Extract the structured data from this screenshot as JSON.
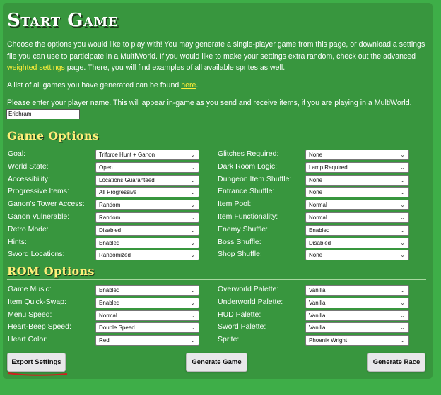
{
  "title": "Start Game",
  "intro": {
    "p1_a": "Choose the options you would like to play with! You may generate a single-player game from this page, or download a settings file you can use to participate in a MultiWorld. If you would like to make your settings extra random, check out the advanced ",
    "p1_link": "weighted settings",
    "p1_b": " page. There, you will find examples of all available sprites as well.",
    "p2_a": "A list of all games you have generated can be found ",
    "p2_link": "here",
    "p2_b": ".",
    "p3": "Please enter your player name. This will appear in-game as you send and receive items, if you are playing in a MultiWorld."
  },
  "player_name": "Eriphram",
  "game_options": {
    "heading": "Game Options",
    "left": [
      {
        "label": "Goal:",
        "value": "Triforce Hunt + Ganon"
      },
      {
        "label": "World State:",
        "value": "Open"
      },
      {
        "label": "Accessibility:",
        "value": "Locations Guaranteed"
      },
      {
        "label": "Progressive Items:",
        "value": "All Progressive"
      },
      {
        "label": "Ganon's Tower Access:",
        "value": "Random"
      },
      {
        "label": "Ganon Vulnerable:",
        "value": "Random"
      },
      {
        "label": "Retro Mode:",
        "value": "Disabled"
      },
      {
        "label": "Hints:",
        "value": "Enabled"
      },
      {
        "label": "Sword Locations:",
        "value": "Randomized"
      }
    ],
    "right": [
      {
        "label": "Glitches Required:",
        "value": "None"
      },
      {
        "label": "Dark Room Logic:",
        "value": "Lamp Required"
      },
      {
        "label": "Dungeon Item Shuffle:",
        "value": "None"
      },
      {
        "label": "Entrance Shuffle:",
        "value": "None"
      },
      {
        "label": "Item Pool:",
        "value": "Normal"
      },
      {
        "label": "Item Functionality:",
        "value": "Normal"
      },
      {
        "label": "Enemy Shuffle:",
        "value": "Enabled"
      },
      {
        "label": "Boss Shuffle:",
        "value": "Disabled"
      },
      {
        "label": "Shop Shuffle:",
        "value": "None"
      }
    ]
  },
  "rom_options": {
    "heading": "ROM Options",
    "left": [
      {
        "label": "Game Music:",
        "value": "Enabled"
      },
      {
        "label": "Item Quick-Swap:",
        "value": "Enabled"
      },
      {
        "label": "Menu Speed:",
        "value": "Normal"
      },
      {
        "label": "Heart-Beep Speed:",
        "value": "Double Speed"
      },
      {
        "label": "Heart Color:",
        "value": "Red"
      }
    ],
    "right": [
      {
        "label": "Overworld Palette:",
        "value": "Vanilla"
      },
      {
        "label": "Underworld Palette:",
        "value": "Vanilla"
      },
      {
        "label": "HUD Palette:",
        "value": "Vanilla"
      },
      {
        "label": "Sword Palette:",
        "value": "Vanilla"
      },
      {
        "label": "Sprite:",
        "value": "Phoenix Wright"
      }
    ]
  },
  "buttons": {
    "export": "Export Settings",
    "generate_game": "Generate Game",
    "generate_race": "Generate Race"
  },
  "colors": {
    "background": "#3eae48",
    "panel": "#38963e",
    "heading": "#ffef7a",
    "link": "#ffef3a",
    "annotation": "#d02020"
  }
}
